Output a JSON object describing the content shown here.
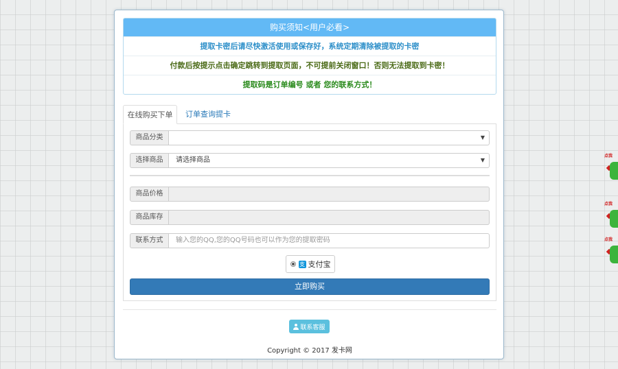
{
  "notice": {
    "title": "购买须知<用户必看>",
    "lines": [
      "提取卡密后请尽快激活使用或保存好，系统定期清除被提取的卡密",
      "付款后按提示点击确定跳转到提取页面，不可提前关闭窗口！否则无法提取到卡密！",
      "提取码是订单编号 或者 您的联系方式！"
    ]
  },
  "tabs": [
    {
      "label": "在线购买下单",
      "active": true
    },
    {
      "label": "订单查询提卡",
      "active": false
    }
  ],
  "form": {
    "category": {
      "label": "商品分类",
      "value": ""
    },
    "product": {
      "label": "选择商品",
      "value": "请选择商品"
    },
    "price": {
      "label": "商品价格",
      "value": ""
    },
    "stock": {
      "label": "商品库存",
      "value": ""
    },
    "contact": {
      "label": "联系方式",
      "placeholder": "输入您的QQ,您的QQ号码也可以作为您的提取密码"
    },
    "payment": {
      "label": "支付宝",
      "icon": "alipay-icon",
      "selected": true
    },
    "buy_label": "立即购买"
  },
  "footer": {
    "contact_label": "联系客服",
    "copyright": "Copyright © 2017 发卡网"
  },
  "side": {
    "tag": "点我"
  },
  "colors": {
    "notice_header": "#62b9f5",
    "primary": "#337ab7",
    "info": "#5bc0de"
  }
}
